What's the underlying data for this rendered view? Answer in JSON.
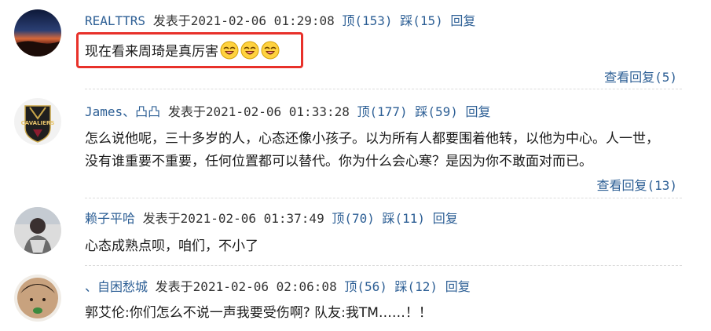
{
  "comments": [
    {
      "username": "REALTTRS",
      "posted_label": "发表于",
      "timestamp": "2021-02-06 01:29:08",
      "upvote": "顶(153)",
      "downvote": "踩(15)",
      "reply": "回复",
      "text": "现在看来周琦是真厉害",
      "emoji_icon": "laughing-face-icon",
      "emoji_count": 3,
      "view_replies": "查看回复(5)",
      "highlighted": true
    },
    {
      "username": "James、凸凸",
      "posted_label": "发表于",
      "timestamp": "2021-02-06 01:33:28",
      "upvote": "顶(177)",
      "downvote": "踩(59)",
      "reply": "回复",
      "text_line1": "怎么说他呢，三十多岁的人，心态还像小孩子。以为所有人都要围着他转，以他为中心。人一世，",
      "text_line2": "没有谁重要不重要，任何位置都可以替代。你为什么会心寒？是因为你不敢面对而已。",
      "view_replies": "查看回复(13)",
      "avatar_text": "CAVALIERS"
    },
    {
      "username": "赖子平哈",
      "posted_label": "发表于",
      "timestamp": "2021-02-06 01:37:49",
      "upvote": "顶(70)",
      "downvote": "踩(11)",
      "reply": "回复",
      "text": "心态成熟点呗，咱们，不小了"
    },
    {
      "username": "、自困愁城",
      "posted_label": "发表于",
      "timestamp": "2021-02-06 02:06:08",
      "upvote": "顶(56)",
      "downvote": "踩(12)",
      "reply": "回复",
      "text": "郭艾伦:你们怎么不说一声我要受伤啊? 队友:我TM……！！"
    }
  ],
  "colors": {
    "link": "#2d5f95",
    "highlight_border": "#e8312a",
    "text": "#1a1a1a"
  }
}
